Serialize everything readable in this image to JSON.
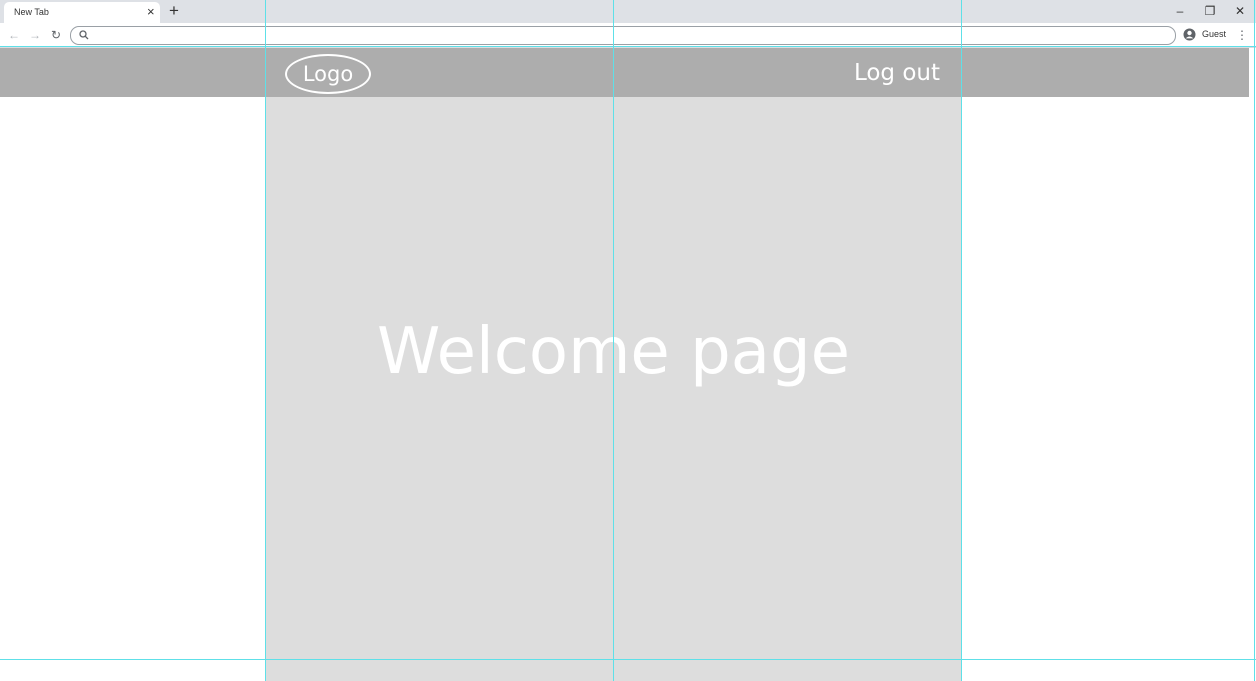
{
  "browser": {
    "tab_title": "New Tab",
    "tab_close": "×",
    "new_tab": "+",
    "window_controls": {
      "minimize": "–",
      "restore": "❐",
      "close": "✕"
    },
    "nav": {
      "back": "←",
      "forward": "→",
      "reload": "↻"
    },
    "address": {
      "value": "",
      "placeholder": ""
    },
    "profile_label": "Guest",
    "menu": "⋮"
  },
  "page": {
    "logo_text": "Logo",
    "logout_label": "Log out",
    "welcome_heading": "Welcome page"
  },
  "colors": {
    "header_bar": "#adadad",
    "content_panel": "#dddddd",
    "guides": "#5ee0e8",
    "text_on_gray": "#ffffff"
  }
}
